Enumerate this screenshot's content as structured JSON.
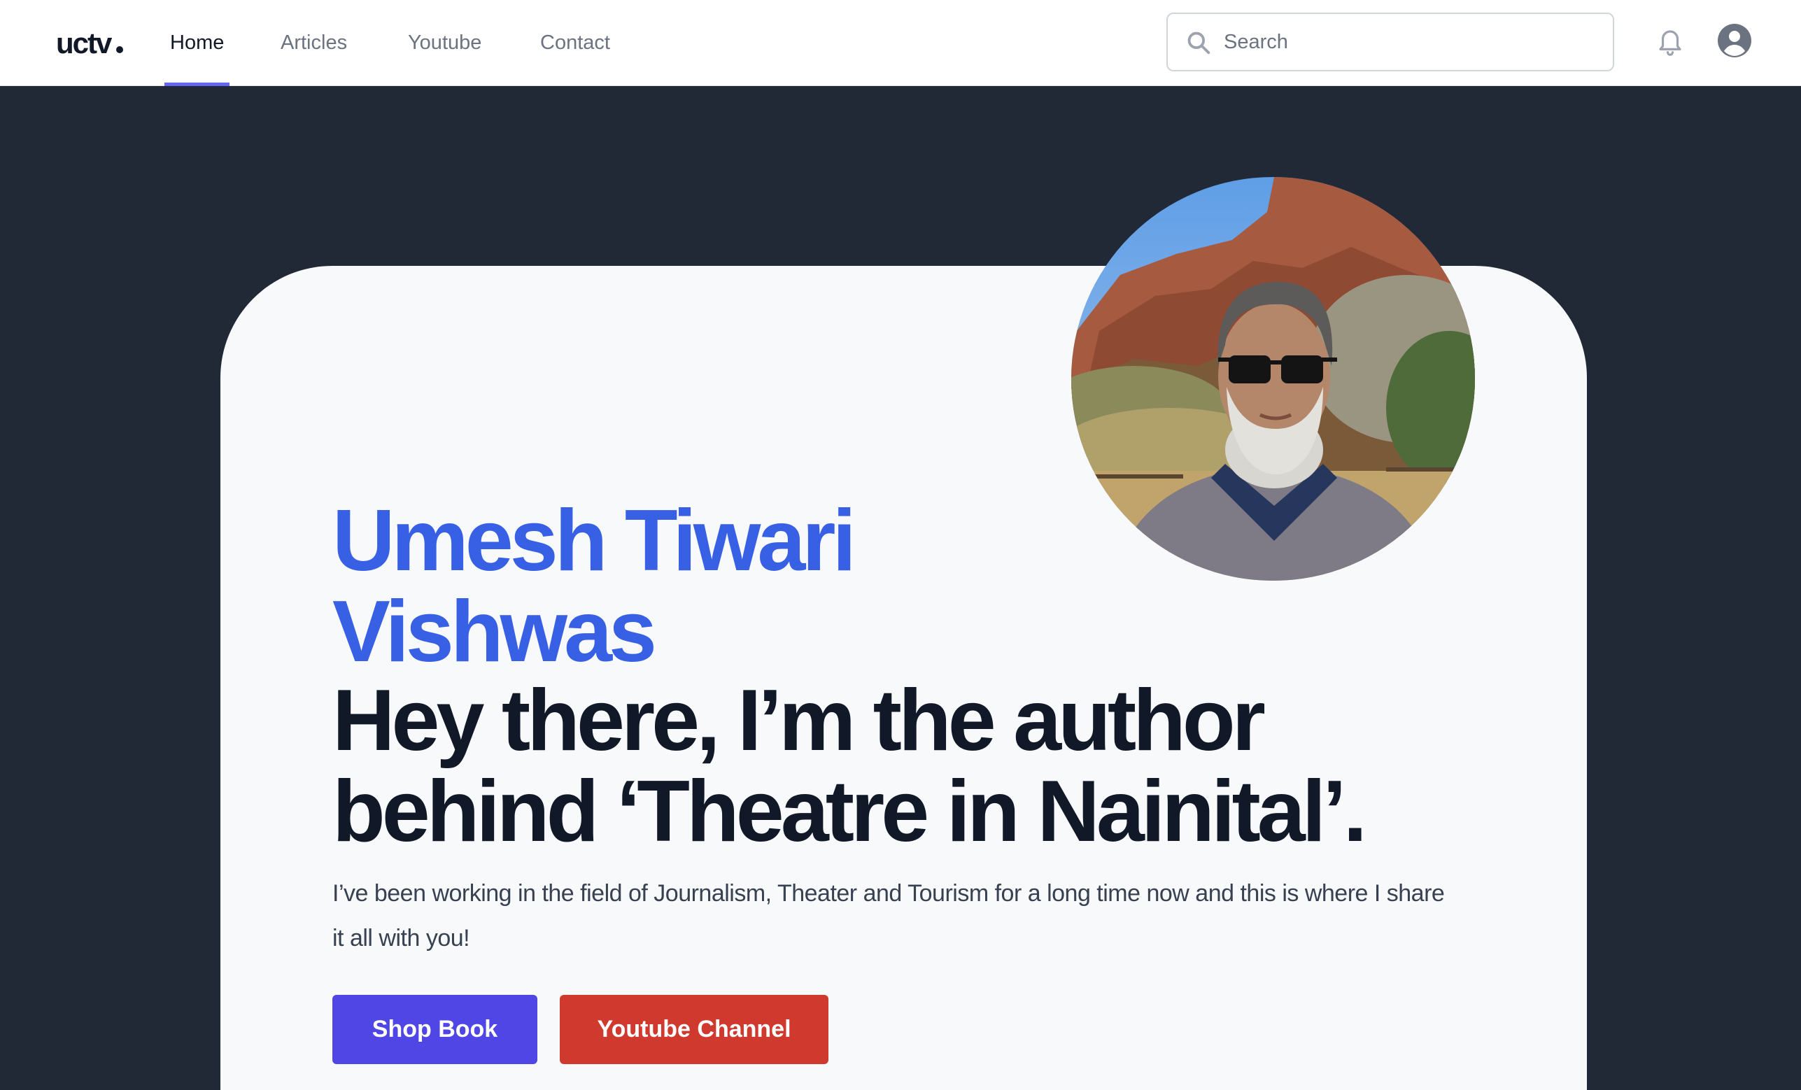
{
  "brand": {
    "logo_text": "uctv"
  },
  "nav": {
    "items": [
      {
        "label": "Home",
        "active": true
      },
      {
        "label": "Articles",
        "active": false
      },
      {
        "label": "Youtube",
        "active": false
      },
      {
        "label": "Contact",
        "active": false
      }
    ]
  },
  "search": {
    "placeholder": "Search",
    "value": ""
  },
  "header_icons": {
    "notifications": "bell-icon",
    "profile": "user-circle-icon"
  },
  "hero": {
    "name": "Umesh Tiwari Vishwas",
    "tagline": "Hey there, I’m the author behind ‘Theatre in Nainital’.",
    "intro": "I’ve been working in the field of Journalism, Theater and Tourism for a long time now and this is where I share it all with you!",
    "buttons": {
      "shop": "Shop Book",
      "youtube": "Youtube Channel"
    }
  },
  "colors": {
    "accent_blue": "#3860e4",
    "nav_active_underline": "#6366f1",
    "shop_button": "#4f46e5",
    "youtube_button": "#d03a2e",
    "page_background": "#212836",
    "card_background": "#f8f9fb"
  }
}
